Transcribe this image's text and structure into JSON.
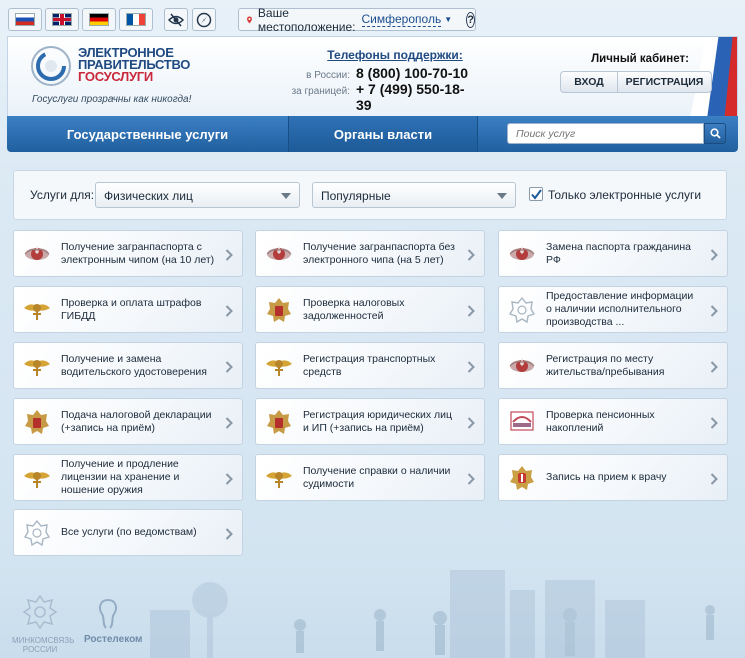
{
  "topbar": {
    "languages": [
      {
        "code": "ru",
        "name": "ru-flag-icon"
      },
      {
        "code": "uk",
        "name": "uk-flag-icon"
      },
      {
        "code": "de",
        "name": "de-flag-icon"
      },
      {
        "code": "fr",
        "name": "fr-flag-icon"
      }
    ],
    "location_label": "Ваше местоположение:",
    "location_city": "Симферополь",
    "help_symbol": "?"
  },
  "header": {
    "logo_line1": "ЭЛЕКТРОННОЕ",
    "logo_line2": "ПРАВИТЕЛЬСТВО",
    "logo_line3": "ГОСУСЛУГИ",
    "slogan": "Госуслуги прозрачны как никогда!",
    "phones_title": "Телефоны поддержки:",
    "phone_ru_label": "в России:",
    "phone_ru": "8 (800) 100-70-10",
    "phone_abroad_label": "за границей:",
    "phone_abroad": "+ 7 (499) 550-18-39",
    "cabinet_title": "Личный кабинет:",
    "login_label": "ВХОД",
    "register_label": "РЕГИСТРАЦИЯ"
  },
  "nav": {
    "tab1": "Государственные услуги",
    "tab2": "Органы власти",
    "search_placeholder": "Поиск услуг"
  },
  "filter": {
    "label": "Услуги для:",
    "audience": "Физических лиц",
    "sort": "Популярные",
    "electronic_only": "Только электронные услуги",
    "electronic_checked": true
  },
  "services": [
    {
      "label": "Получение загранпаспорта с электронным чипом (на 10 лет)",
      "emblem": "mvd"
    },
    {
      "label": "Получение загранпаспорта без электронного чипа (на 5 лет)",
      "emblem": "mvd"
    },
    {
      "label": "Замена паспорта гражданина РФ",
      "emblem": "mvd"
    },
    {
      "label": "Проверка и оплата штрафов ГИБДД",
      "emblem": "gibdd"
    },
    {
      "label": "Проверка налоговых задолженностей",
      "emblem": "fns"
    },
    {
      "label": "Предоставление информации о наличии исполнительного производства ...",
      "emblem": "fssp"
    },
    {
      "label": "Получение и замена водительского удостоверения",
      "emblem": "gibdd"
    },
    {
      "label": "Регистрация транспортных средств",
      "emblem": "gibdd"
    },
    {
      "label": "Регистрация по месту жительства/пребывания",
      "emblem": "mvd"
    },
    {
      "label": "Подача налоговой декларации (+запись на приём)",
      "emblem": "fns"
    },
    {
      "label": "Регистрация юридических лиц и ИП (+запись на приём)",
      "emblem": "fns"
    },
    {
      "label": "Проверка пенсионных накоплений",
      "emblem": "pfr"
    },
    {
      "label": "Получение и продление лицензии на хранение и ношение оружия",
      "emblem": "gibdd"
    },
    {
      "label": "Получение справки о наличии судимости",
      "emblem": "gibdd"
    },
    {
      "label": "Запись на прием к врачу",
      "emblem": "minzdrav"
    },
    {
      "label": "Все услуги (по ведомствам)",
      "emblem": "fssp"
    }
  ],
  "footer": {
    "ministry": "МИНКОМСВЯЗЬ РОССИИ",
    "partner": "Ростелеком"
  },
  "colors": {
    "nav_blue": "#2c6cae",
    "accent_red": "#c8283a",
    "link_blue": "#1d4f91"
  }
}
